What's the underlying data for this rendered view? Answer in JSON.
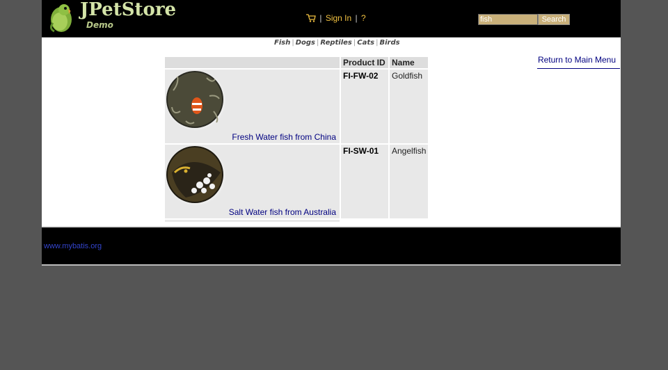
{
  "header": {
    "logo_title": "JPetStore",
    "logo_subtitle": "Demo",
    "sign_in_label": "Sign In",
    "help_label": "?",
    "separator": "|",
    "search": {
      "value": "fish",
      "button_label": "Search"
    }
  },
  "quicklinks": [
    "Fish",
    "Dogs",
    "Reptiles",
    "Cats",
    "Birds"
  ],
  "back_link": "Return to Main Menu",
  "catalog": {
    "headers": [
      "",
      "Product ID",
      "Name"
    ],
    "rows": [
      {
        "caption": "Fresh Water fish from China",
        "product_id": "FI-FW-02",
        "name": "Goldfish"
      },
      {
        "caption": "Salt Water fish from Australia",
        "product_id": "FI-SW-01",
        "name": "Angelfish"
      }
    ]
  },
  "footer": {
    "link": "www.mybatis.org"
  },
  "colors": {
    "header_bg": "#000000",
    "menu_link": "#f0c040",
    "link_blue": "#000080",
    "page_bg": "#555555"
  }
}
